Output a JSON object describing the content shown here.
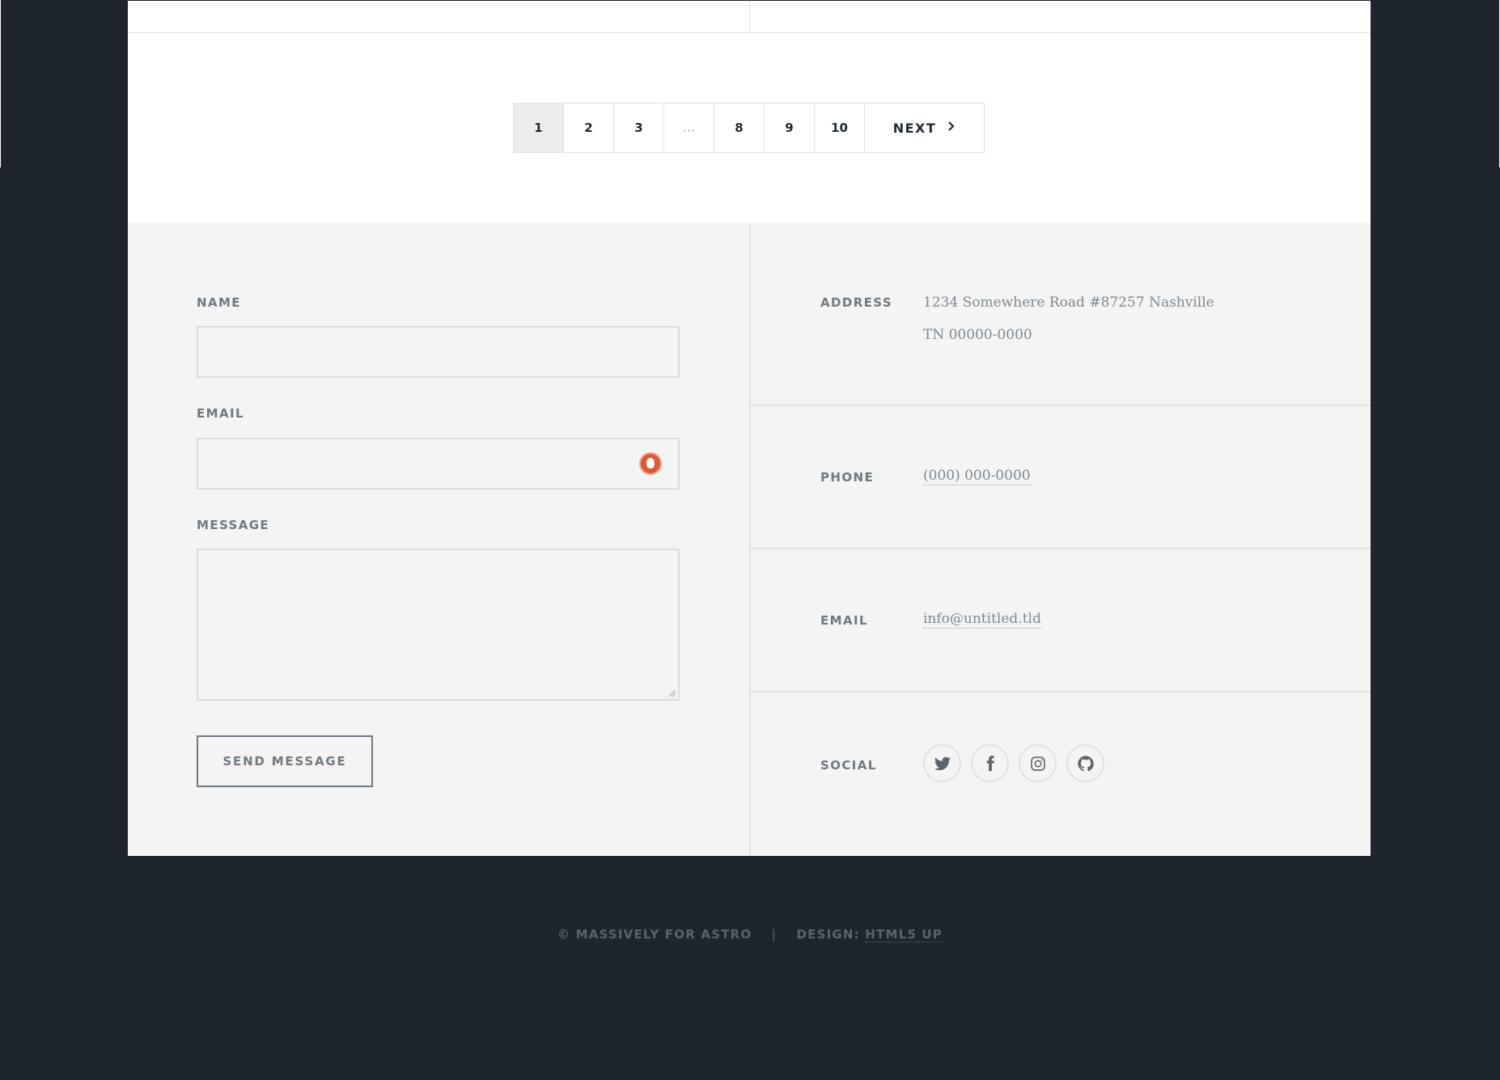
{
  "pagination": {
    "pages": [
      "1",
      "2",
      "3",
      "…",
      "8",
      "9",
      "10"
    ],
    "active": "1",
    "next_label": "Next",
    "next_icon": "chevron-right-icon"
  },
  "contact_form": {
    "name_label": "Name",
    "email_label": "Email",
    "message_label": "Message",
    "name_value": "",
    "email_value": "",
    "message_value": "",
    "submit_label": "Send Message"
  },
  "contact_info": {
    "address_label": "Address",
    "address_line1": "1234 Somewhere Road #87257 Nashville",
    "address_line2": "TN 00000-0000",
    "phone_label": "Phone",
    "phone_value": "(000) 000-0000",
    "email_label": "Email",
    "email_value": "info@untitled.tld",
    "social_label": "Social",
    "social_icons": [
      "twitter-icon",
      "facebook-icon",
      "instagram-icon",
      "github-icon"
    ]
  },
  "copyright": {
    "text": "© Massively for Astro",
    "separator": "|",
    "design_prefix": "Design:",
    "design_link": "HTML5 UP"
  },
  "colors": {
    "page_background": "#1e252d",
    "panel_background": "#f4f4f4",
    "text_muted": "#717981",
    "text_dark": "#212931"
  }
}
